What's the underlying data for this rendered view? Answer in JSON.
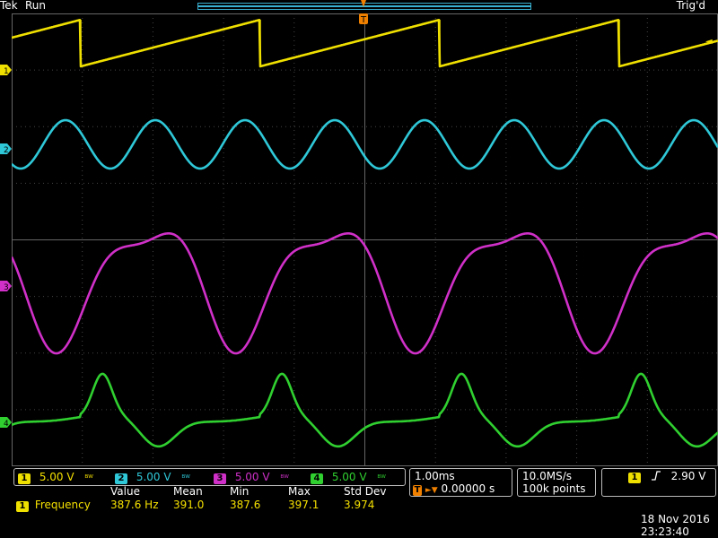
{
  "top": {
    "brand": "Tek",
    "status": "Run",
    "trigger_state": "Trig'd"
  },
  "channels": [
    {
      "id": "1",
      "color": "#f0e000",
      "scale": "5.00 V"
    },
    {
      "id": "2",
      "color": "#2fc8d8",
      "scale": "5.00 V"
    },
    {
      "id": "3",
      "color": "#d030c8",
      "scale": "5.00 V"
    },
    {
      "id": "4",
      "color": "#30d030",
      "scale": "5.00 V"
    }
  ],
  "bw_icon": "bandwidth-limit-icon",
  "measurement": {
    "headers": [
      "Value",
      "Mean",
      "Min",
      "Max",
      "Std Dev"
    ],
    "source": "1",
    "name": "Frequency",
    "value": "387.6 Hz",
    "mean": "391.0",
    "min": "387.6",
    "max": "397.1",
    "std_dev": "3.974"
  },
  "horizontal": {
    "scale": "1.00ms",
    "trigger_pos_badge": "T",
    "delay": "0.00000 s"
  },
  "acquisition": {
    "rate": "10.0MS/s",
    "points": "100k points"
  },
  "trigger": {
    "source": "1",
    "slope_icon": "rising-edge-icon",
    "level": "2.90 V"
  },
  "datetime": {
    "date": "18 Nov 2016",
    "time": "23:23:40"
  },
  "markers": {
    "trigger_time": "T",
    "trigger_level_arrow": "◄"
  }
}
